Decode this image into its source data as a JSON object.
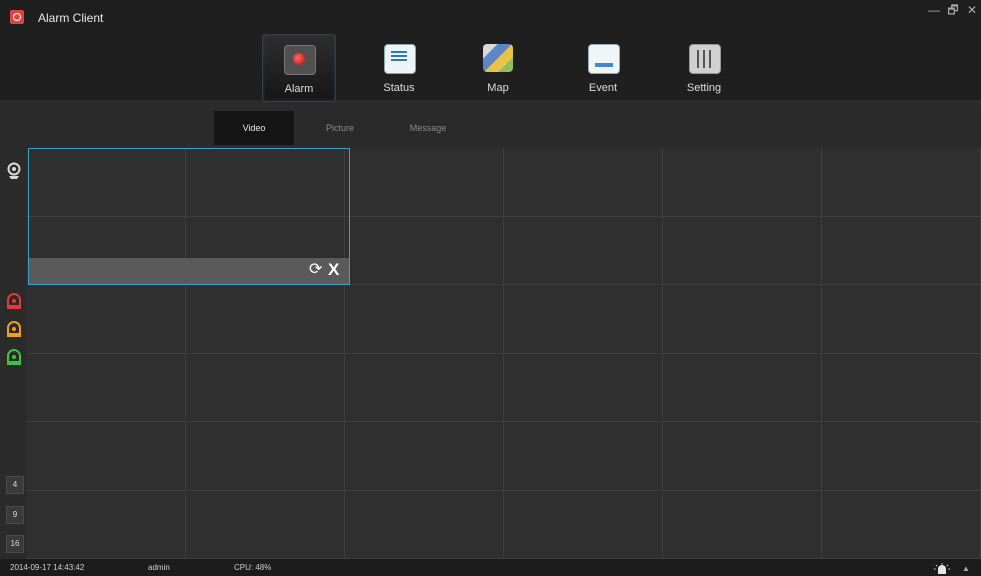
{
  "window": {
    "title": "Alarm Client",
    "minimize": "—",
    "restore": "🗗",
    "close": "✕"
  },
  "topnav": {
    "items": [
      {
        "label": "Alarm",
        "icon": "alarm-light-icon",
        "active": true
      },
      {
        "label": "Status",
        "icon": "status-document-icon",
        "active": false
      },
      {
        "label": "Map",
        "icon": "map-icon",
        "active": false
      },
      {
        "label": "Event",
        "icon": "event-list-icon",
        "active": false
      },
      {
        "label": "Setting",
        "icon": "setting-sliders-icon",
        "active": false
      }
    ]
  },
  "subtabs": [
    {
      "label": "Video",
      "active": true
    },
    {
      "label": "Picture",
      "active": false
    },
    {
      "label": "Message",
      "active": false
    }
  ],
  "sidebar": {
    "icons": [
      {
        "name": "camera-location-icon",
        "color": "#d9d9d9"
      },
      {
        "name": "alarm-red-icon",
        "color": "#e53935"
      },
      {
        "name": "alarm-orange-icon",
        "color": "#f0a020"
      },
      {
        "name": "alarm-green-icon",
        "color": "#3cc43c"
      }
    ],
    "layouts": [
      "4",
      "9",
      "16"
    ]
  },
  "video": {
    "active_window_actions": {
      "refresh": "⟳",
      "close": "X"
    }
  },
  "statusbar": {
    "datetime": "2014-09-17 14:43:42",
    "user": "admin",
    "cpu": "CPU: 48%",
    "scroll_up": "▲"
  },
  "colors": {
    "accent": "#3ca0c8",
    "background": "#2b2b2b",
    "header": "#1f1f1f"
  }
}
